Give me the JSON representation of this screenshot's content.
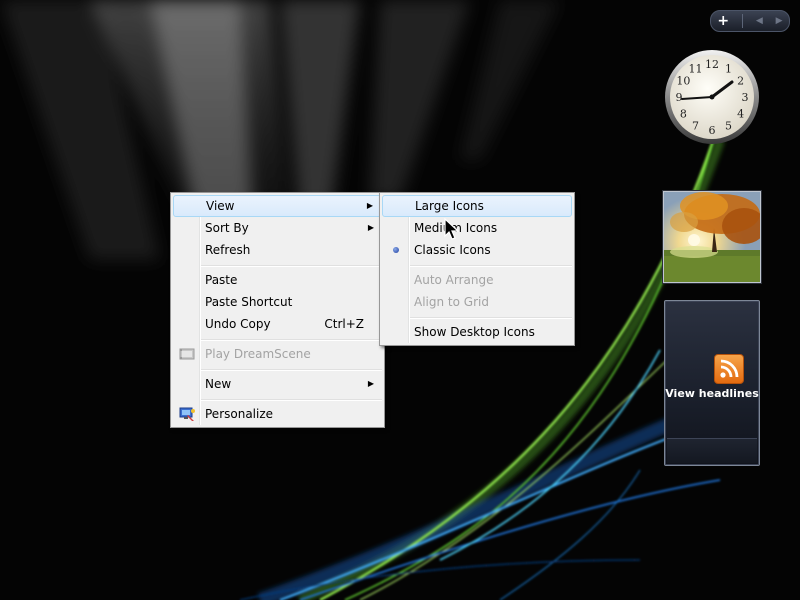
{
  "context_menu": {
    "items": [
      {
        "label": "View",
        "submenu": true,
        "highlighted": true
      },
      {
        "label": "Sort By",
        "submenu": true
      },
      {
        "label": "Refresh"
      },
      {
        "label": "Paste"
      },
      {
        "label": "Paste Shortcut"
      },
      {
        "label": "Undo Copy",
        "shortcut": "Ctrl+Z"
      },
      {
        "label": "Play DreamScene",
        "disabled": true,
        "icon": "dreamscene-icon"
      },
      {
        "label": "New",
        "submenu": true
      },
      {
        "label": "Personalize",
        "icon": "personalize-icon"
      }
    ]
  },
  "view_submenu": {
    "items": [
      {
        "label": "Large Icons",
        "highlighted": true
      },
      {
        "label": "Medium Icons"
      },
      {
        "label": "Classic Icons",
        "selected": true
      },
      {
        "label": "Auto Arrange",
        "disabled": true
      },
      {
        "label": "Align to Grid",
        "disabled": true
      },
      {
        "label": "Show Desktop Icons"
      }
    ]
  },
  "sidebar": {
    "controls": {
      "add_label": "+",
      "prev_icon": "chevron-left-icon",
      "next_icon": "chevron-right-icon"
    },
    "clock": {
      "numbers": [
        "12",
        "1",
        "2",
        "3",
        "4",
        "5",
        "6",
        "7",
        "8",
        "9",
        "10",
        "11"
      ]
    },
    "feed": {
      "headline": "View headlines",
      "icon": "rss-icon"
    }
  },
  "colors": {
    "menu_background": "#f0f0f0",
    "menu_highlight": "#d9eafc",
    "disabled_text": "#a3a3a3",
    "rss_orange": "#e36b10"
  }
}
